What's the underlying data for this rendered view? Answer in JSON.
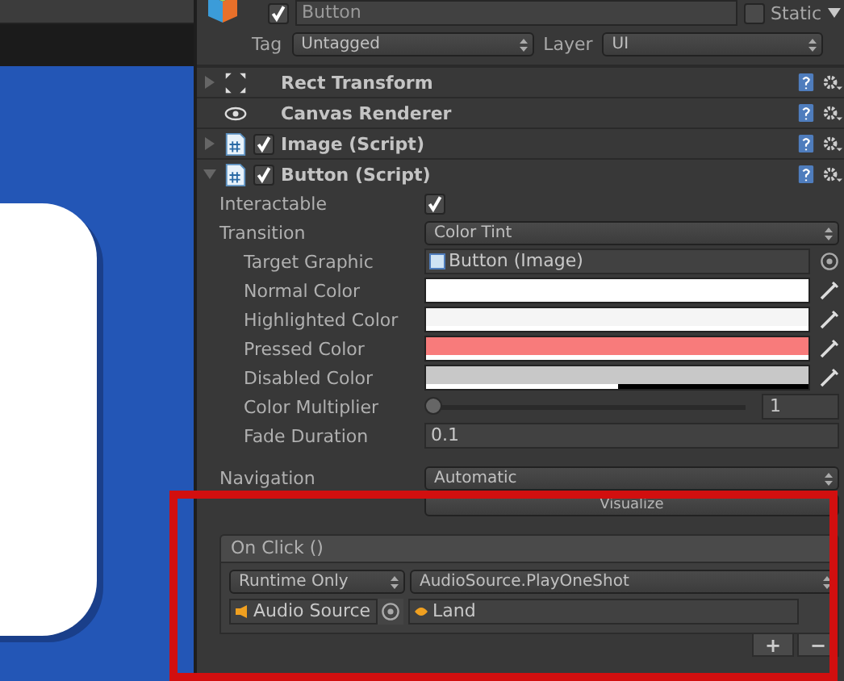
{
  "object": {
    "active": true,
    "name": "Button",
    "static_label": "Static",
    "static": false,
    "tag_label": "Tag",
    "tag": "Untagged",
    "layer_label": "Layer",
    "layer": "UI"
  },
  "components": [
    {
      "name": "Rect Transform",
      "kind": "transform",
      "expanded": false
    },
    {
      "name": "Canvas Renderer",
      "kind": "renderer"
    },
    {
      "name": "Image (Script)",
      "kind": "script",
      "expanded": false,
      "enabled": true
    },
    {
      "name": "Button (Script)",
      "kind": "script",
      "expanded": true,
      "enabled": true
    }
  ],
  "properties": [
    {
      "label": "Interactable",
      "kind": "checkbox",
      "checked": true
    },
    {
      "label": "Transition",
      "kind": "dropdown",
      "value": "Color Tint",
      "children": [
        {
          "label": "Target Graphic",
          "kind": "object",
          "value": "Button (Image)"
        },
        {
          "label": "Normal Color",
          "kind": "color",
          "color": "#ffffff",
          "level": 1
        },
        {
          "label": "Highlighted Color",
          "kind": "color",
          "color": "#f5f5f5",
          "level": 1
        },
        {
          "label": "Pressed Color",
          "kind": "color",
          "color": "#f87b7b",
          "level": 1
        },
        {
          "label": "Disabled Color",
          "kind": "color",
          "color": "#c8c8c8",
          "level": 0.5
        },
        {
          "label": "Color Multiplier",
          "kind": "slider",
          "level": 0,
          "value": "1"
        },
        {
          "label": "Fade Duration",
          "kind": "text",
          "value": "0.1"
        }
      ]
    },
    {
      "label": "Navigation",
      "kind": "dropdown",
      "value": "Automatic"
    },
    {
      "kind": "button",
      "value": "Visualize"
    }
  ],
  "on_click": {
    "title": "On Click ()",
    "entries": [
      {
        "mode": "Runtime Only",
        "function": "AudioSource.PlayOneShot",
        "target": "Audio Source",
        "argument": "Land"
      }
    ],
    "buttons": [
      "+",
      "−"
    ]
  }
}
